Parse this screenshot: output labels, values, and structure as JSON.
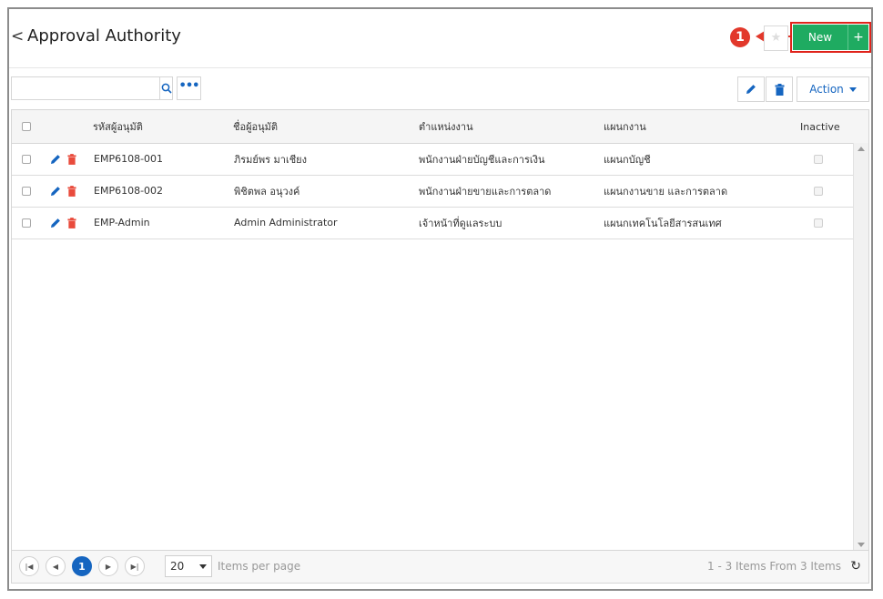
{
  "header": {
    "back_glyph": "<",
    "title": "Approval Authority",
    "marker": "1"
  },
  "toolbar": {
    "new_label": "New",
    "new_plus": "+",
    "search_placeholder": "",
    "more_label": "•••",
    "action_label": "Action"
  },
  "grid": {
    "columns": [
      "รหัสผู้อนุมัติ",
      "ชื่อผู้อนุมัติ",
      "ตำแหน่งงาน",
      "แผนกงาน",
      "Inactive"
    ],
    "rows": [
      {
        "code": "EMP6108-001",
        "name": "ภิรมย์พร มาเชียง",
        "position": "พนักงานฝ่ายบัญชีและการเงิน",
        "department": "แผนกบัญชี"
      },
      {
        "code": "EMP6108-002",
        "name": "พิชิตพล อนุวงค์",
        "position": "พนักงานฝ่ายขายและการตลาด",
        "department": "แผนกงานขาย และการตลาด"
      },
      {
        "code": "EMP-Admin",
        "name": "Admin Administrator",
        "position": "เจ้าหน้าที่ดูแลระบบ",
        "department": "แผนกเทคโนโลยีสารสนเทศ"
      }
    ]
  },
  "pager": {
    "current_page": "1",
    "page_size": "20",
    "items_per_page_label": "Items per page",
    "info": "1 - 3 Items From 3 Items"
  },
  "colors": {
    "primary": "#1565c0",
    "success": "#1fab61",
    "danger": "#e0231b",
    "delete_icon": "#e94b3c"
  },
  "icons": [
    "chevron-left-icon",
    "star-icon",
    "plus-icon",
    "search-icon",
    "more-icon",
    "pencil-icon",
    "trash-icon",
    "caret-down-icon",
    "first-page-icon",
    "prev-page-icon",
    "next-page-icon",
    "last-page-icon",
    "refresh-icon"
  ]
}
